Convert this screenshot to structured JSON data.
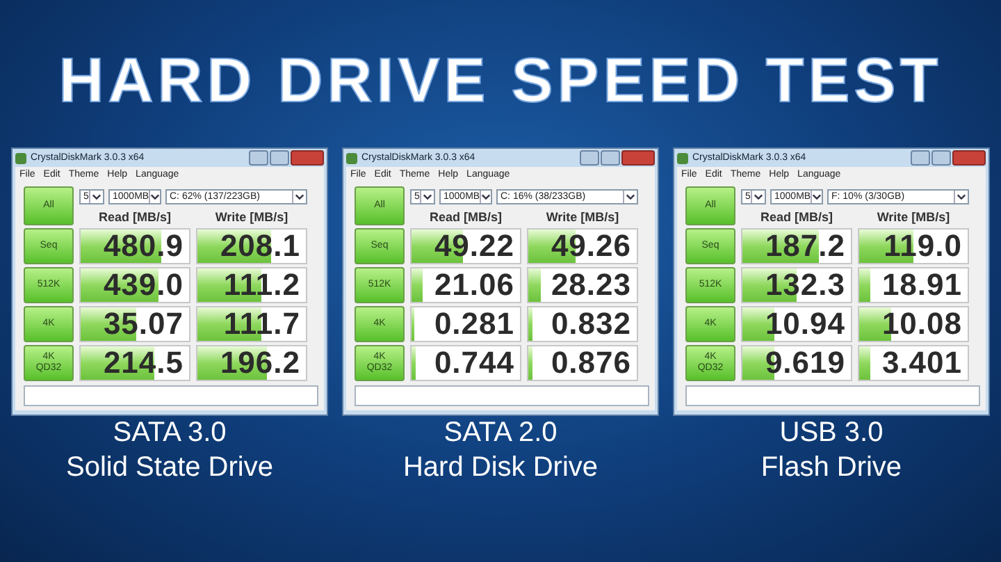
{
  "title": "HARD DRIVE SPEED TEST",
  "panels": [
    {
      "window_title": "CrystalDiskMark 3.0.3 x64",
      "menu": [
        "File",
        "Edit",
        "Theme",
        "Help",
        "Language"
      ],
      "run_all": "All",
      "count": "5",
      "size": "1000MB",
      "drive": "C: 62% (137/223GB)",
      "headers": [
        "Read [MB/s]",
        "Write [MB/s]"
      ],
      "rows": [
        {
          "label": [
            "Seq"
          ],
          "read": {
            "value": "480.9",
            "level": 0.74
          },
          "write": {
            "value": "208.1",
            "level": 0.68
          }
        },
        {
          "label": [
            "512K"
          ],
          "read": {
            "value": "439.0",
            "level": 0.72
          },
          "write": {
            "value": "111.2",
            "level": 0.59
          }
        },
        {
          "label": [
            "4K"
          ],
          "read": {
            "value": "35.07",
            "level": 0.51
          },
          "write": {
            "value": "111.7",
            "level": 0.59
          }
        },
        {
          "label": [
            "4K",
            "QD32"
          ],
          "read": {
            "value": "214.5",
            "level": 0.68
          },
          "write": {
            "value": "196.2",
            "level": 0.64
          }
        }
      ],
      "caption": [
        "SATA 3.0",
        "Solid State Drive"
      ]
    },
    {
      "window_title": "CrystalDiskMark 3.0.3 x64",
      "menu": [
        "File",
        "Edit",
        "Theme",
        "Help",
        "Language"
      ],
      "run_all": "All",
      "count": "5",
      "size": "1000MB",
      "drive": "C: 16% (38/233GB)",
      "headers": [
        "Read [MB/s]",
        "Write [MB/s]"
      ],
      "rows": [
        {
          "label": [
            "Seq"
          ],
          "read": {
            "value": "49.22",
            "level": 0.47
          },
          "write": {
            "value": "49.26",
            "level": 0.44
          }
        },
        {
          "label": [
            "512K"
          ],
          "read": {
            "value": "21.06",
            "level": 0.1
          },
          "write": {
            "value": "28.23",
            "level": 0.12
          }
        },
        {
          "label": [
            "4K"
          ],
          "read": {
            "value": "0.281",
            "level": 0.03
          },
          "write": {
            "value": "0.832",
            "level": 0.04
          }
        },
        {
          "label": [
            "4K",
            "QD32"
          ],
          "read": {
            "value": "0.744",
            "level": 0.04
          },
          "write": {
            "value": "0.876",
            "level": 0.04
          }
        }
      ],
      "caption": [
        "SATA 2.0",
        "Hard Disk Drive"
      ]
    },
    {
      "window_title": "CrystalDiskMark 3.0.3 x64",
      "menu": [
        "File",
        "Edit",
        "Theme",
        "Help",
        "Language"
      ],
      "run_all": "All",
      "count": "5",
      "size": "1000MB",
      "drive": "F: 10% (3/30GB)",
      "headers": [
        "Read [MB/s]",
        "Write [MB/s]"
      ],
      "rows": [
        {
          "label": [
            "Seq"
          ],
          "read": {
            "value": "187.2",
            "level": 0.7
          },
          "write": {
            "value": "119.0",
            "level": 0.5
          }
        },
        {
          "label": [
            "512K"
          ],
          "read": {
            "value": "132.3",
            "level": 0.5
          },
          "write": {
            "value": "18.91",
            "level": 0.1
          }
        },
        {
          "label": [
            "4K"
          ],
          "read": {
            "value": "10.94",
            "level": 0.3
          },
          "write": {
            "value": "10.08",
            "level": 0.3
          }
        },
        {
          "label": [
            "4K",
            "QD32"
          ],
          "read": {
            "value": "9.619",
            "level": 0.3
          },
          "write": {
            "value": "3.401",
            "level": 0.1
          }
        }
      ],
      "caption": [
        "USB 3.0",
        "Flash Drive"
      ]
    }
  ]
}
